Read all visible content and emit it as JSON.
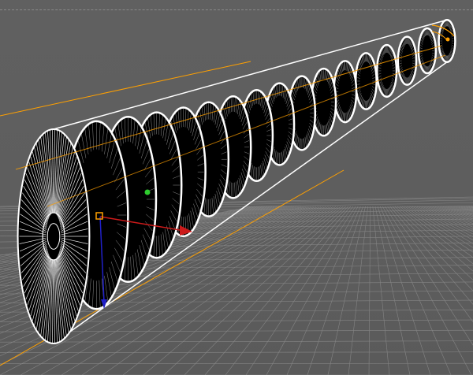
{
  "viewport": {
    "view": "perspective",
    "display_mode": "wireframe",
    "colors": {
      "background": "#5e5e5e",
      "grid": "#858585",
      "selection": "#ffa000",
      "wire": "#ffffff",
      "axis_x": "#cc1a1a",
      "axis_y": "#2ecc2e",
      "axis_z": "#2020c8"
    },
    "object": {
      "type": "tube",
      "segments_visible": 16
    },
    "gizmo": {
      "axes": [
        "x",
        "y",
        "z"
      ]
    },
    "icons": [
      "move-gizmo-icon",
      "object-handle-icon"
    ]
  }
}
